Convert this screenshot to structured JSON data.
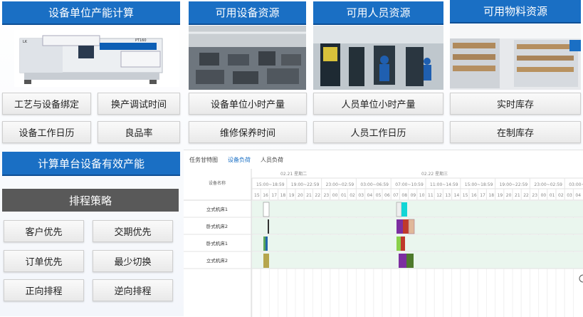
{
  "headers": {
    "unit_capacity_calc": "设备单位产能计算",
    "available_equipment": "可用设备资源",
    "available_personnel": "可用人员资源",
    "available_materials": "可用物料资源",
    "effective_capacity": "计算单台设备有效产能",
    "scheduling_strategy": "排程策略"
  },
  "left_buttons": [
    "工艺与设备绑定",
    "换产调试时间",
    "设备工作日历",
    "良品率"
  ],
  "equipment_buttons": [
    "设备单位小时产量",
    "维修保养时间"
  ],
  "personnel_buttons": [
    "人员单位小时产量",
    "人员工作日历"
  ],
  "material_buttons": [
    "实时库存",
    "在制库存"
  ],
  "strategy_buttons": [
    "客户优先",
    "交期优先",
    "订单优先",
    "最少切换",
    "正向排程",
    "逆向排程"
  ],
  "machine_label": "PT160",
  "brand_label": "LK",
  "gantt": {
    "tabs": [
      "任务甘特图",
      "设备负荷",
      "人员负荷"
    ],
    "active_tab": "设备负荷",
    "col_header": "设备名称",
    "dates": [
      "02.21 星期二",
      "02.22 星期三"
    ],
    "shifts": [
      "15:00~18:59",
      "19:00~22:59",
      "23:00~02:59",
      "03:00~06:59",
      "07:00~10:59",
      "11:00~14:59",
      "15:00~18:59",
      "19:00~22:59",
      "23:00~02:59",
      "03:00~"
    ],
    "hours": [
      "15",
      "16",
      "17",
      "18",
      "19",
      "20",
      "21",
      "22",
      "23",
      "00",
      "01",
      "02",
      "03",
      "04",
      "05",
      "06",
      "07",
      "08",
      "09",
      "10",
      "11",
      "12",
      "13",
      "14",
      "15",
      "16",
      "17",
      "18",
      "19",
      "20",
      "21",
      "22",
      "23",
      "00",
      "01",
      "02",
      "03",
      "04"
    ],
    "rows": [
      "立式机床1",
      "卧式机床2",
      "卧式机床1",
      "立式机床2"
    ]
  },
  "colors": {
    "brand_blue": "#1a6fc4",
    "strategy_gray": "#595959"
  }
}
